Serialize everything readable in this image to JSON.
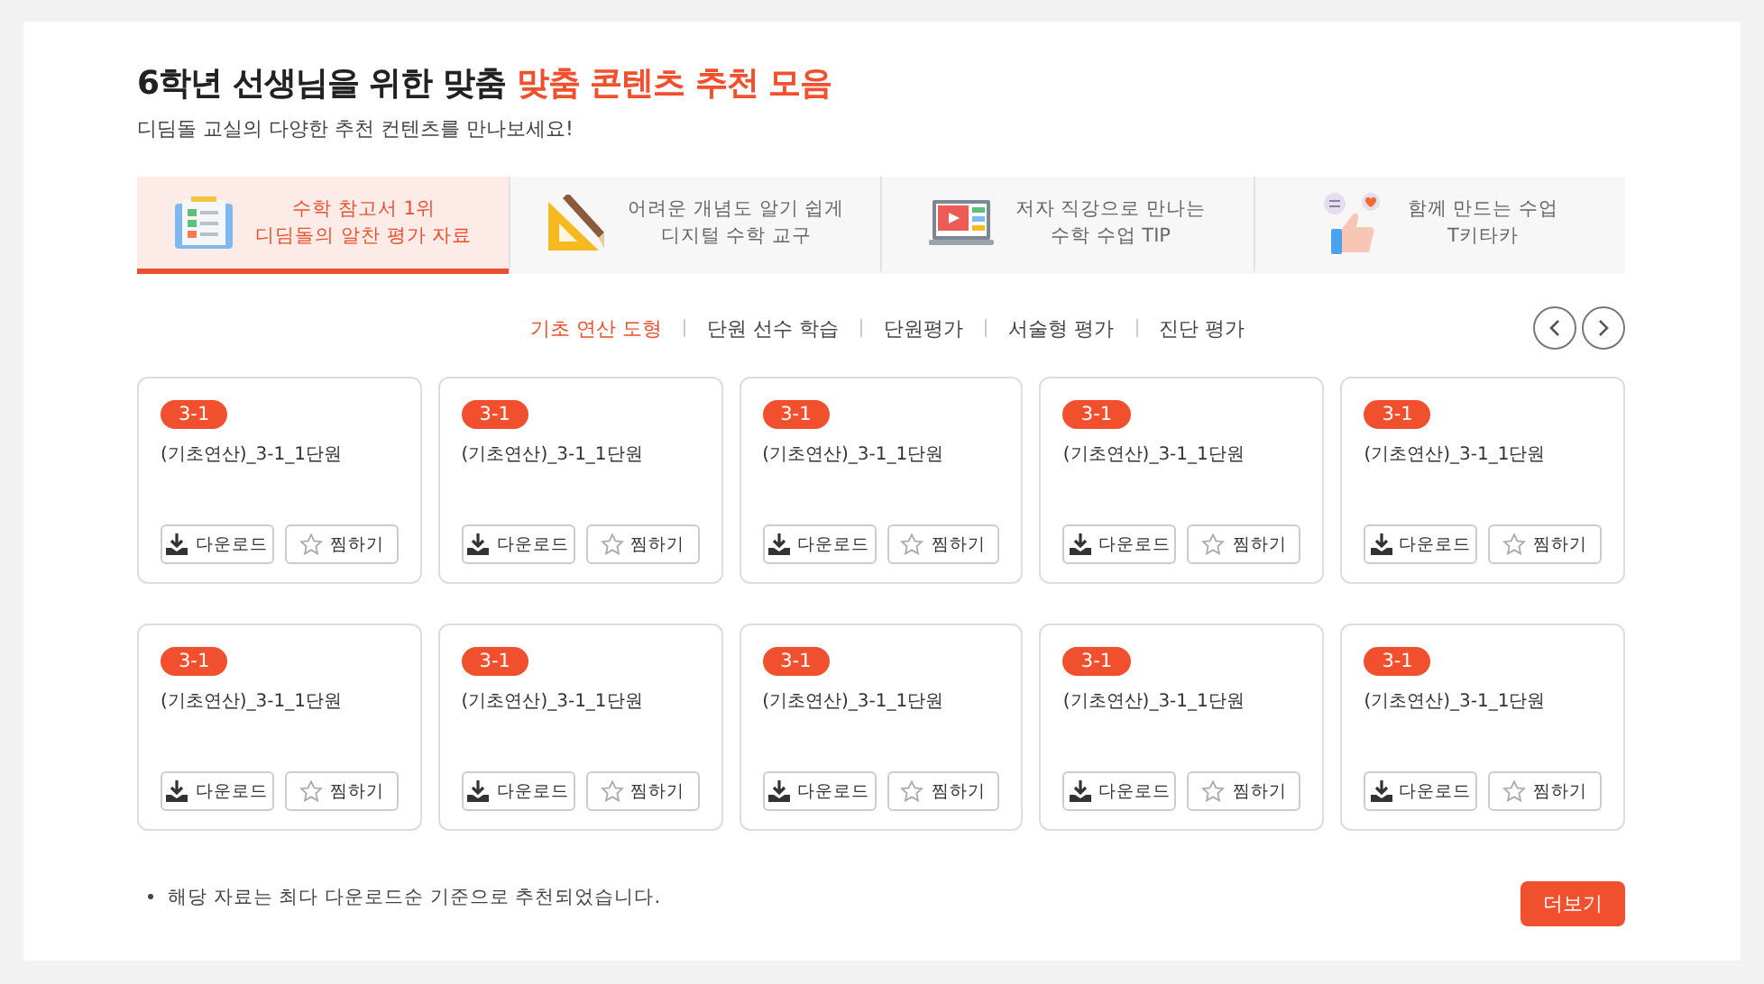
{
  "header": {
    "title": "6학년 선생님을 위한 맞춤",
    "title_highlight": "맞춤 콘텐츠 추천 모음",
    "subtitle": "디딤돌 교실의 다양한 추천 컨텐츠를 만나보세요!"
  },
  "tabs": [
    {
      "kind": "checklist",
      "lines": [
        "수학 참고서 1위",
        "디딤돌의 알찬 평가 자료"
      ],
      "selected": true
    },
    {
      "kind": "ruler",
      "lines": [
        "어려운 개념도 알기 쉽게",
        "디지털 수학 교구"
      ],
      "selected": false
    },
    {
      "kind": "video",
      "lines": [
        "저자 직강으로 만나는",
        "수학 수업 TIP"
      ],
      "selected": false
    },
    {
      "kind": "thumb",
      "lines": [
        "함께 만드는 수업",
        "T키타카"
      ],
      "selected": false
    }
  ],
  "filters": [
    {
      "label": "기초 연산 도형",
      "selected": true
    },
    {
      "label": "단원 선수 학습",
      "selected": false
    },
    {
      "label": "단원평가",
      "selected": false
    },
    {
      "label": "서술형 평가",
      "selected": false
    },
    {
      "label": "진단 평가",
      "selected": false
    }
  ],
  "cards": [
    {
      "badge": "3-1",
      "title": "(기초연산)_3-1_1단원",
      "download": "다운로드",
      "favorite": "찜하기"
    },
    {
      "badge": "3-1",
      "title": "(기초연산)_3-1_1단원",
      "download": "다운로드",
      "favorite": "찜하기"
    },
    {
      "badge": "3-1",
      "title": "(기초연산)_3-1_1단원",
      "download": "다운로드",
      "favorite": "찜하기"
    },
    {
      "badge": "3-1",
      "title": "(기초연산)_3-1_1단원",
      "download": "다운로드",
      "favorite": "찜하기"
    },
    {
      "badge": "3-1",
      "title": "(기초연산)_3-1_1단원",
      "download": "다운로드",
      "favorite": "찜하기"
    },
    {
      "badge": "3-1",
      "title": "(기초연산)_3-1_1단원",
      "download": "다운로드",
      "favorite": "찜하기"
    },
    {
      "badge": "3-1",
      "title": "(기초연산)_3-1_1단원",
      "download": "다운로드",
      "favorite": "찜하기"
    },
    {
      "badge": "3-1",
      "title": "(기초연산)_3-1_1단원",
      "download": "다운로드",
      "favorite": "찜하기"
    },
    {
      "badge": "3-1",
      "title": "(기초연산)_3-1_1단원",
      "download": "다운로드",
      "favorite": "찜하기"
    },
    {
      "badge": "3-1",
      "title": "(기초연산)_3-1_1단원",
      "download": "다운로드",
      "favorite": "찜하기"
    }
  ],
  "footer": {
    "note": "해당 자료는 최다 다운로드순 기준으로 추천되었습니다.",
    "more_button": "더보기"
  }
}
